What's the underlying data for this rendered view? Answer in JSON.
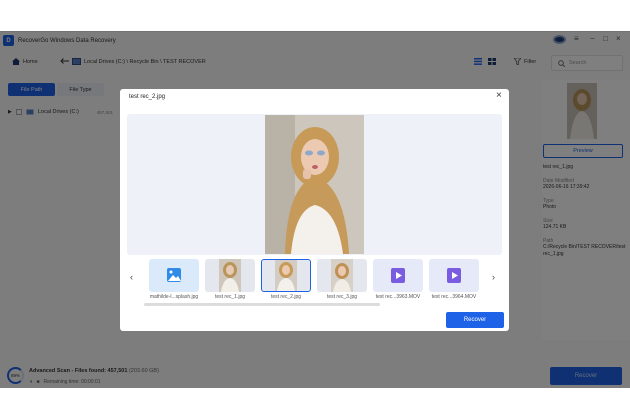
{
  "app": {
    "title": "RecoverGo Windows Data Recovery",
    "logo_letter": "D",
    "window_controls": [
      "≡",
      "−",
      "□",
      "×"
    ]
  },
  "nav": {
    "home": "Home",
    "breadcrumb": "Local Drives (C:) \\ Recycle Bin \\ TEST RECOVER",
    "filter": "Filter",
    "search_placeholder": "Search"
  },
  "sidebar": {
    "tabs": [
      "File Path",
      "File Type"
    ],
    "drive": "Local Drives (C:)",
    "drive_count": "457,501"
  },
  "details": {
    "preview_label": "Preview",
    "name": "test rec_1.jpg",
    "date_label": "Date Modified",
    "date": "2026-06-16 17:39:42",
    "type_label": "Type",
    "type": "Photo",
    "size_label": "Size",
    "size": "124.71 KB",
    "path_label": "Path",
    "path": "C:/Recycle Bin/TEST RECOVER/test rec_1.jpg"
  },
  "status": {
    "progress": "89%",
    "scan_label": "Advanced Scan - Files found:",
    "files_found": "457,501",
    "total_size": "(203.60 GB)",
    "remaining": "Remaining time: 00:00:01",
    "recover_label": "Recover"
  },
  "modal": {
    "title": "test rec_2.jpg",
    "recover_label": "Recover",
    "thumbnails": [
      {
        "label": "mathilde-l...splash.jpg",
        "kind": "image-icon"
      },
      {
        "label": "test rec_1.jpg",
        "kind": "photo"
      },
      {
        "label": "test rec_2.jpg",
        "kind": "photo",
        "selected": true
      },
      {
        "label": "test rec_3.jpg",
        "kind": "photo"
      },
      {
        "label": "test rec...3963.MOV",
        "kind": "video-icon"
      },
      {
        "label": "test rec...3964.MOV",
        "kind": "video-icon"
      }
    ]
  },
  "colors": {
    "accent": "#1e62e8",
    "overlay": "#000000"
  }
}
